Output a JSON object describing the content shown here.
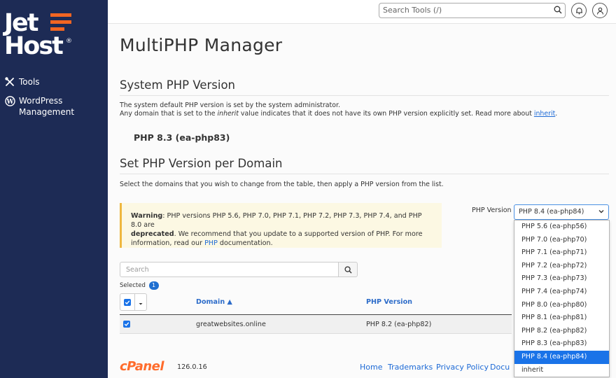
{
  "brand": {
    "logo_line1": "Jet",
    "logo_line2": "Host",
    "reg_mark": "®",
    "accent_color": "#f26522",
    "sidebar_color": "#1d2b55"
  },
  "sidebar": {
    "items": [
      {
        "label": "Tools",
        "icon": "tools-icon"
      },
      {
        "label": "WordPress Management",
        "icon": "wordpress-icon"
      }
    ]
  },
  "topbar": {
    "search_placeholder": "Search Tools (/)",
    "notification_icon": "bell-icon",
    "user_icon": "user-icon"
  },
  "page": {
    "title": "MultiPHP Manager",
    "system_section_title": "System PHP Version",
    "system_desc_line1": "The system default PHP version is set by the system administrator.",
    "system_desc_line2_pre": "Any domain that is set to the ",
    "system_desc_line2_em": "inherit",
    "system_desc_line2_post": " value indicates that it does not have its own PHP version explicitly set. Read more about ",
    "system_desc_link": "inherit",
    "system_desc_end": ".",
    "system_version": "PHP 8.3 (ea-php83)",
    "domain_section_title": "Set PHP Version per Domain",
    "domain_desc": "Select the domains that you wish to change from the table, then apply a PHP version from the list."
  },
  "warning": {
    "label": "Warning",
    "text1": ": PHP versions PHP 5.6, PHP 7.0, PHP 7.1, PHP 7.2, PHP 7.3, PHP 7.4, and PHP 8.0 are",
    "bold2": "deprecated",
    "text2": ". We recommend that you update to a supported version of PHP. For more",
    "text3_pre": "information, read our ",
    "link": "PHP",
    "text3_post": " documentation."
  },
  "php_select": {
    "label": "PHP Version",
    "selected": "PHP 8.4 (ea-php84)",
    "options": [
      "PHP 5.6 (ea-php56)",
      "PHP 7.0 (ea-php70)",
      "PHP 7.1 (ea-php71)",
      "PHP 7.2 (ea-php72)",
      "PHP 7.3 (ea-php73)",
      "PHP 7.4 (ea-php74)",
      "PHP 8.0 (ea-php80)",
      "PHP 8.1 (ea-php81)",
      "PHP 8.2 (ea-php82)",
      "PHP 8.3 (ea-php83)",
      "PHP 8.4 (ea-php84)",
      "inherit"
    ],
    "highlighted_index": 10
  },
  "table": {
    "search_placeholder": "Search",
    "selected_label": "Selected",
    "selected_count": "1",
    "columns": {
      "domain": "Domain ▲",
      "php_version": "PHP Version"
    },
    "rows": [
      {
        "domain": "greatwebsites.online",
        "php_version": "PHP 8.2 (ea-php82)",
        "checked": true
      }
    ]
  },
  "footer": {
    "cpanel_logo": "cPanel",
    "version": "126.0.16",
    "links": [
      "Home",
      "Trademarks",
      "Privacy Policy",
      "Docu"
    ]
  }
}
